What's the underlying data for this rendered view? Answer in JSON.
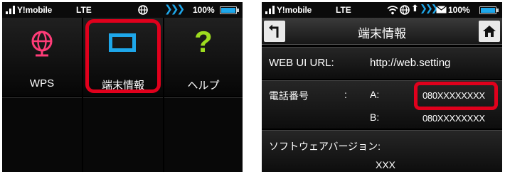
{
  "left": {
    "status": {
      "carrier": "Y!mobile",
      "network": "LTE",
      "battery": "100%"
    },
    "tiles": [
      {
        "label": "WPS"
      },
      {
        "label": "端末情報"
      },
      {
        "label": "ヘルプ"
      }
    ]
  },
  "right": {
    "status": {
      "carrier": "Y!mobile",
      "network": "LTE",
      "battery": "100%"
    },
    "title": "端末情報",
    "webui": {
      "label": "WEB UI URL:",
      "value": "http://web.setting"
    },
    "phone": {
      "label": "電話番号",
      "colon": ":",
      "a_label": "A:",
      "a_value": "080XXXXXXXX",
      "b_label": "B:",
      "b_value": "080XXXXXXXX"
    },
    "software": {
      "label": "ソフトウェアバージョン:",
      "value": "XXX"
    }
  },
  "colors": {
    "accent_blue": "#1ea7ea",
    "highlight_red": "#e0001c",
    "wps_pink": "#ff3c78",
    "help_green": "#9ddc1f"
  }
}
